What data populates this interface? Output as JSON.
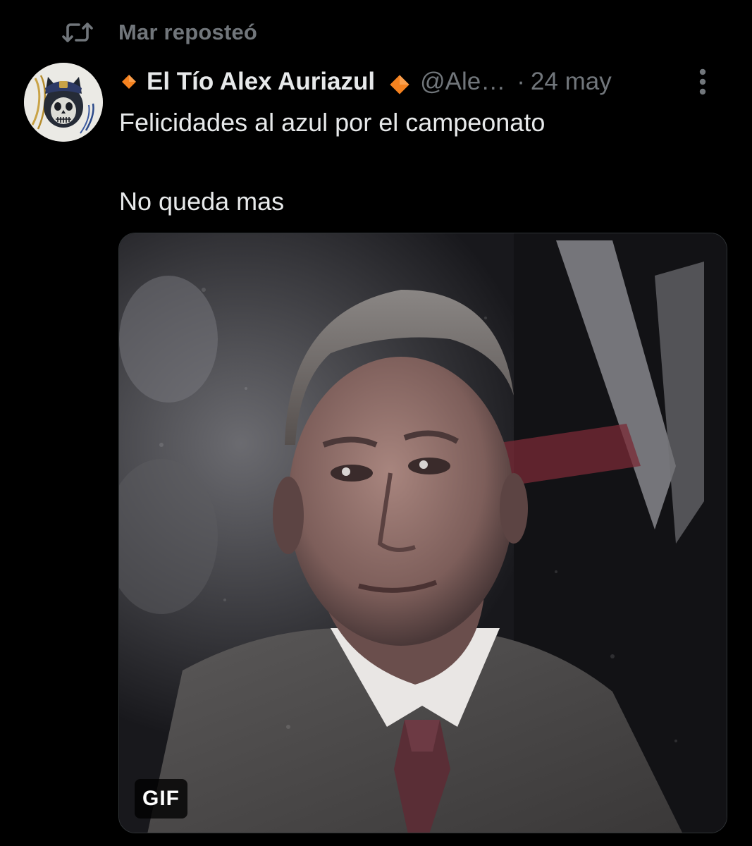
{
  "repost": {
    "icon": "repost-icon",
    "label": "Mar reposteó"
  },
  "post": {
    "avatar_icon": "cat-skull-avatar-icon",
    "badge_icon": "orange-diamond-icon",
    "author_name": "El Tío Alex Auriazul",
    "handle": "@Ale…",
    "separator": "·",
    "date": "24 may",
    "more_icon": "more-vertical-icon",
    "text_lines": [
      "Felicidades al azul por el campeonato",
      "No queda mas"
    ],
    "media": {
      "type": "gif",
      "badge_label": "GIF"
    }
  },
  "colors": {
    "background": "#000000",
    "primary_text": "#e7e9ea",
    "secondary_text": "#71767b",
    "diamond_orange": "#f5821f",
    "media_border": "#2f3336"
  }
}
